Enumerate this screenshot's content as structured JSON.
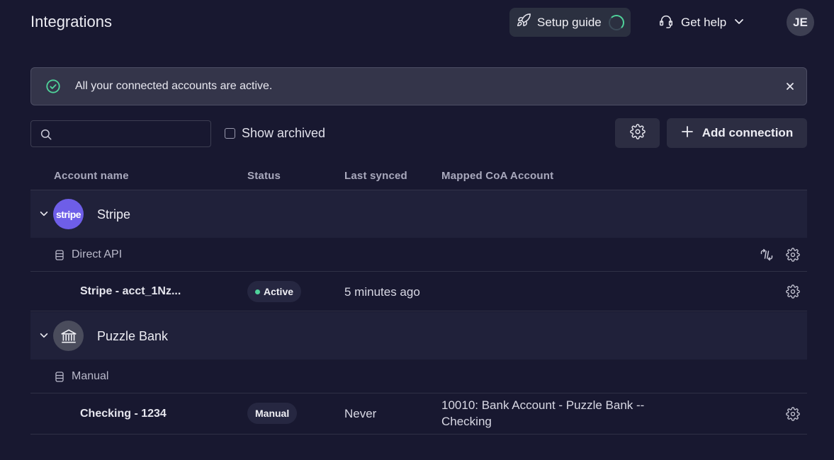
{
  "header": {
    "title": "Integrations",
    "setup_guide_label": "Setup guide",
    "get_help_label": "Get help",
    "avatar_initials": "JE"
  },
  "banner": {
    "message": "All your connected accounts are active.",
    "icon": "check-circle-icon"
  },
  "toolbar": {
    "search_value": "",
    "search_placeholder": "",
    "show_archived_label": "Show archived",
    "show_archived_checked": false,
    "add_connection_label": "Add connection"
  },
  "table": {
    "columns": [
      "Account name",
      "Status",
      "Last synced",
      "Mapped CoA Account"
    ],
    "groups": [
      {
        "name": "Stripe",
        "logo_text": "stripe",
        "connection_type": "Direct API",
        "accounts": [
          {
            "name": "Stripe - acct_1Nz...",
            "status": "Active",
            "last_synced": "5 minutes ago",
            "mapped": ""
          }
        ]
      },
      {
        "name": "Puzzle Bank",
        "logo_icon": "bank-icon",
        "connection_type": "Manual",
        "accounts": [
          {
            "name": "Checking - 1234",
            "status": "Manual",
            "last_synced": "Never",
            "mapped": "10010: Bank Account - Puzzle Bank -- Checking"
          }
        ]
      }
    ]
  },
  "colors": {
    "background": "#181830",
    "accent_green": "#4fd39a",
    "stripe_purple": "#6e5ee8"
  }
}
